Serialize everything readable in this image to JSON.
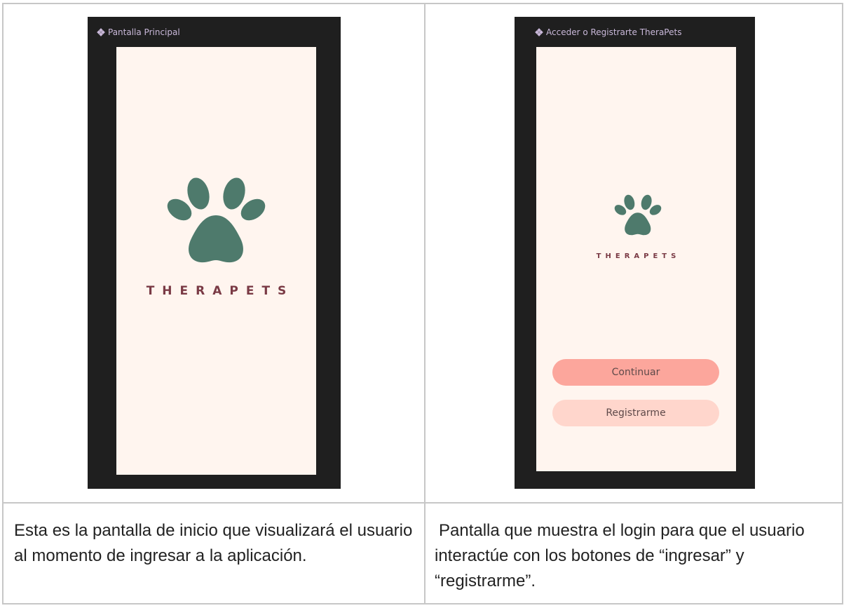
{
  "left_mockup": {
    "frame_title": "Pantalla Principal",
    "brand": "THERAPETS"
  },
  "right_mockup": {
    "frame_title": "Acceder o Registrarte TheraPets",
    "brand": "THERAPETS",
    "continue_label": "Continuar",
    "register_label": "Registrarme"
  },
  "captions": {
    "left": "Esta es la pantalla de inicio que visualizará el usuario al momento de ingresar a la aplicación.",
    "right": "Pantalla que muestra el login para que el usuario interactúe con los botones de “ingresar” y “registrarme”."
  },
  "colors": {
    "frame": "#1f1f1f",
    "screen": "#fff5ef",
    "paw": "#4e7a6c",
    "brand": "#7a3a45",
    "primary_button": "#fca69c",
    "secondary_button": "#ffd6cc"
  },
  "icons": [
    "diamond-component-icon",
    "paw-logo-icon"
  ]
}
